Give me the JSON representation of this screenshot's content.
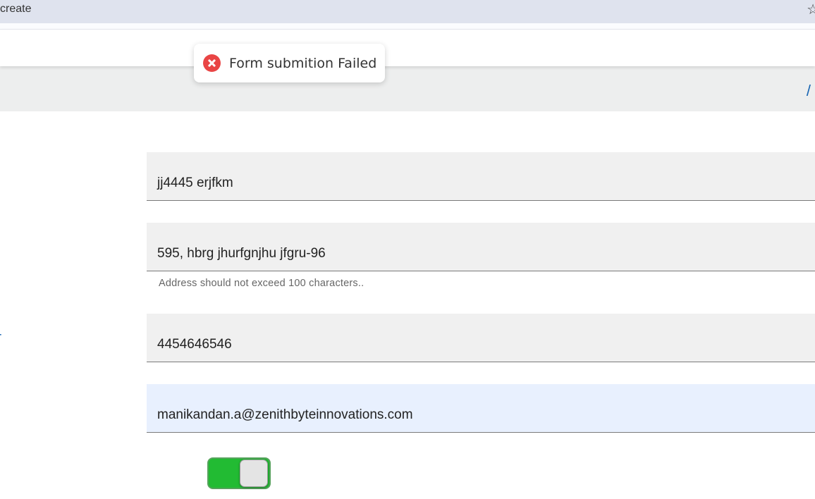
{
  "browser": {
    "url_text": "create",
    "bookmark_icon": "star-icon"
  },
  "toast": {
    "icon": "error-circle-icon",
    "message": "Form submition Failed",
    "accent_color": "#e94545"
  },
  "breadcrumb": {
    "separator": "/"
  },
  "side_label": "r",
  "form": {
    "name_value": "jj4445 erjfkm",
    "address_value": "595, hbrg jhurfgnjhu jfgru-96",
    "address_helper": "Address should not exceed 100 characters..",
    "phone_value": "4454646546",
    "email_value": "manikandan.a@zenithbyteinnovations.com",
    "toggle_on": true,
    "toggle_color": "#22bb33"
  }
}
